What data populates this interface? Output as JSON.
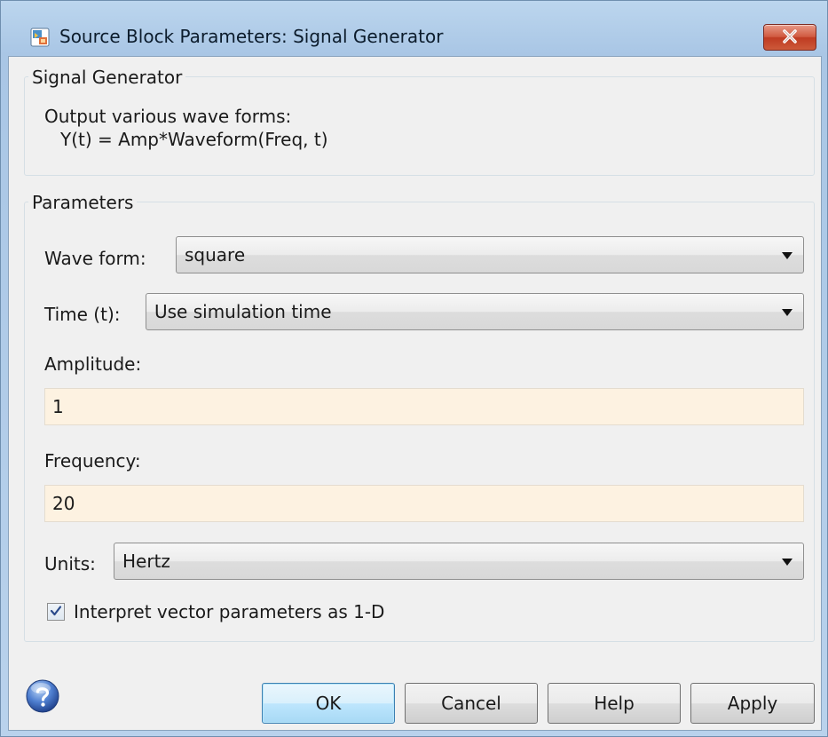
{
  "window": {
    "title": "Source Block Parameters: Signal Generator",
    "close_glyph": "x"
  },
  "description_group": {
    "title": "Signal Generator",
    "lines": [
      "Output various wave forms:",
      "Y(t) = Amp*Waveform(Freq, t)"
    ]
  },
  "parameters_group": {
    "title": "Parameters",
    "wave_form": {
      "label": "Wave form:",
      "value": "square"
    },
    "time": {
      "label": "Time (t):",
      "value": "Use simulation time"
    },
    "amplitude": {
      "label": "Amplitude:",
      "value": "1"
    },
    "frequency": {
      "label": "Frequency:",
      "value": "20"
    },
    "units": {
      "label": "Units:",
      "value": "Hertz"
    },
    "interpret_vector": {
      "label": "Interpret vector parameters as 1-D",
      "checked": true
    }
  },
  "buttons": {
    "ok": "OK",
    "cancel": "Cancel",
    "help": "Help",
    "apply": "Apply"
  },
  "colors": {
    "title_bar": "#a9c6e5",
    "dialog_bg": "#f0f0f0",
    "editable_field_bg": "#fdf2e1",
    "close_button": "#c94b30",
    "default_button": "#3c7fb1"
  },
  "icons": {
    "app": "simulink-block-icon",
    "close": "close-icon",
    "help": "help-question-icon",
    "combo_arrow": "chevron-down-icon",
    "check": "checkmark-icon"
  }
}
